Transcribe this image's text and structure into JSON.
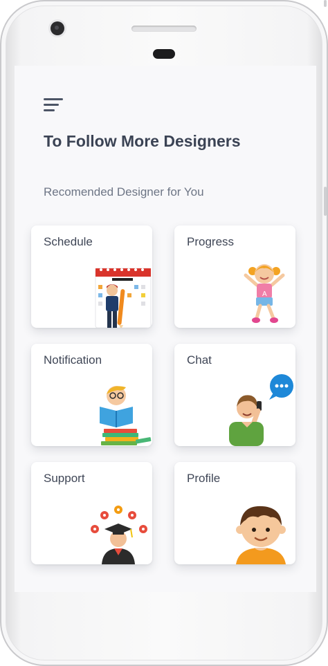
{
  "header": {
    "menu_icon": "hamburger-menu-icon",
    "title": "To Follow More Designers",
    "subtitle": "Recomended Designer for You"
  },
  "cards": [
    {
      "label": "Schedule",
      "icon": "planning-calendar-illustration"
    },
    {
      "label": "Progress",
      "icon": "jumping-girl-illustration"
    },
    {
      "label": "Notification",
      "icon": "boy-reading-book-illustration"
    },
    {
      "label": "Chat",
      "icon": "man-on-phone-chat-illustration"
    },
    {
      "label": "Support",
      "icon": "graduate-student-illustration"
    },
    {
      "label": "Profile",
      "icon": "boy-avatar-illustration"
    }
  ],
  "colors": {
    "screen_background": "#f8f8fa",
    "card_background": "#ffffff",
    "title_text": "#3b4354",
    "subtitle_text": "#6d7585",
    "accent_blue": "#1e88d8",
    "accent_orange": "#f39a1e"
  }
}
